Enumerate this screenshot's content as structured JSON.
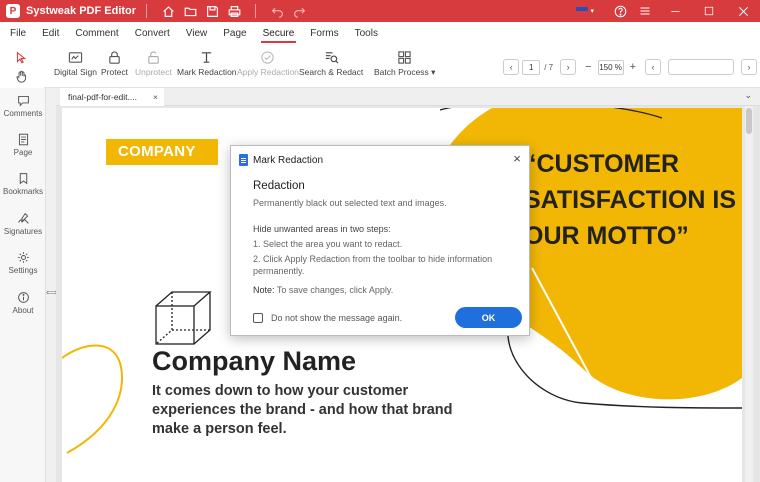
{
  "app": {
    "logo_letter": "P",
    "title": "Systweak PDF Editor",
    "accent_color": "#d83b3e",
    "quick_icons": [
      "home-icon",
      "save-icon",
      "print-icon",
      "undo-icon",
      "redo-icon"
    ],
    "right_icons": [
      "language-flag-icon",
      "help-icon",
      "menu-icon",
      "minimize-icon",
      "maximize-icon",
      "close-icon"
    ]
  },
  "menu": {
    "items": [
      "File",
      "Edit",
      "Comment",
      "Convert",
      "View",
      "Page",
      "Secure",
      "Forms",
      "Tools"
    ],
    "active": "Secure"
  },
  "toolbar": {
    "digital_sign": "Digital Sign",
    "protect": "Protect",
    "unprotect": "Unprotect",
    "mark_redaction": "Mark Redaction",
    "apply_redaction": "Apply Redaction",
    "search_redact": "Search & Redact",
    "batch_process": "Batch Process ▾",
    "current_page": "1",
    "total_pages": "/ 7",
    "zoom": "150 %",
    "zoom_out": "−",
    "zoom_in": "+"
  },
  "sidebar": {
    "items": [
      {
        "label": "Comments",
        "icon": "comment-icon"
      },
      {
        "label": "Page",
        "icon": "page-icon"
      },
      {
        "label": "Bookmarks",
        "icon": "bookmark-icon"
      },
      {
        "label": "Signatures",
        "icon": "signature-icon"
      },
      {
        "label": "Settings",
        "icon": "settings-icon"
      },
      {
        "label": "About",
        "icon": "info-icon"
      }
    ]
  },
  "tab": {
    "name": "final-pdf-for-edit....",
    "close": "×"
  },
  "document": {
    "banner": "COMPANY",
    "quote_lines": [
      "“CUSTOMER",
      "SATISFACTION IS",
      "OUR MOTTO”"
    ],
    "company_name": "Company Name",
    "description": "It comes down to how your customer experiences the brand - and how that brand make a person feel.",
    "yellow": "#f2b705"
  },
  "modal": {
    "title": "Mark Redaction",
    "close": "×",
    "heading": "Redaction",
    "subheading": "Permanently black out selected text and images.",
    "steps_title": "Hide unwanted areas in two steps:",
    "step1": "1. Select the area you want to redact.",
    "step2": "2. Click Apply Redaction from the toolbar to hide information permanently.",
    "note_label": "Note:",
    "note_text": " To save changes, click Apply.",
    "checkbox_label": "Do not show the message again.",
    "ok_label": "OK",
    "ok_color": "#1f6fdc"
  }
}
